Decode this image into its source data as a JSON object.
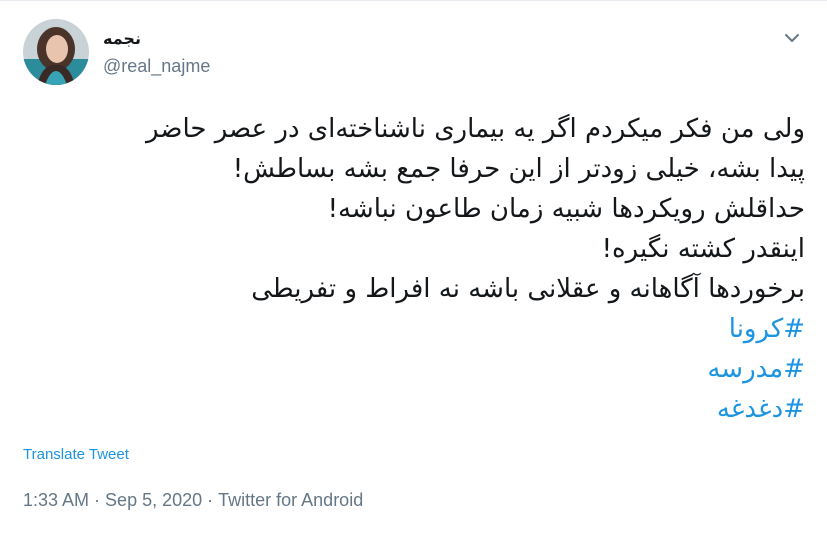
{
  "author": {
    "display_name": "نجمه",
    "handle": "@real_najme",
    "avatar_icon": "profile-photo"
  },
  "menu": {
    "icon": "chevron-down-icon"
  },
  "tweet": {
    "lines": [
      "ولی من فکر میکردم اگر یه بیماری ناشناخته‌ای در عصر حاضر",
      "پیدا بشه، خیلی زودتر از این حرفا جمع بشه بساطش!",
      "حداقلش رویکردها شبیه زمان طاعون نباشه!",
      "اینقدر کشته نگیره!",
      "برخوردها آگاهانه و عقلانی باشه نه افراط و تفریطی"
    ],
    "hashtags": [
      "#کرونا",
      "#مدرسه",
      "#دغدغه"
    ]
  },
  "translate_label": "Translate Tweet",
  "meta": {
    "time": "1:33 AM",
    "separator": " · ",
    "date": "Sep 5, 2020",
    "source": "Twitter for Android"
  },
  "colors": {
    "link": "#1b95e0",
    "secondary_text": "#657786",
    "primary_text": "#14171a"
  }
}
